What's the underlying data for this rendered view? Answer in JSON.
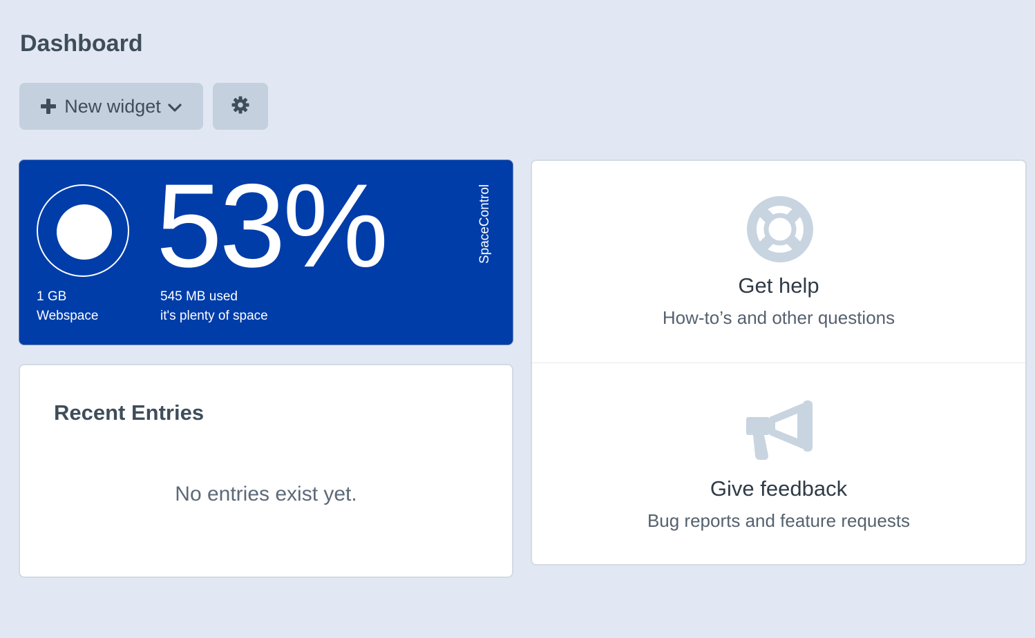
{
  "header": {
    "title": "Dashboard"
  },
  "toolbar": {
    "new_widget_label": "New widget",
    "plus_icon": "plus-icon",
    "chevron_icon": "chevron-down-icon",
    "settings_icon": "gear-icon"
  },
  "space_widget": {
    "percent": "53%",
    "usage_fraction": 0.53,
    "quota_value": "1 GB",
    "quota_label": "Webspace",
    "used_value": "545 MB used",
    "status_text": "it's plenty of space",
    "brand": "SpaceControl",
    "background_color": "#003da9"
  },
  "recent_entries": {
    "title": "Recent Entries",
    "empty_message": "No entries exist yet."
  },
  "help": {
    "get_help": {
      "title": "Get help",
      "subtitle": "How-to’s and other questions",
      "icon": "life-ring-icon"
    },
    "feedback": {
      "title": "Give feedback",
      "subtitle": "Bug reports and feature requests",
      "icon": "megaphone-icon"
    },
    "icon_color": "#c8d4e0"
  }
}
